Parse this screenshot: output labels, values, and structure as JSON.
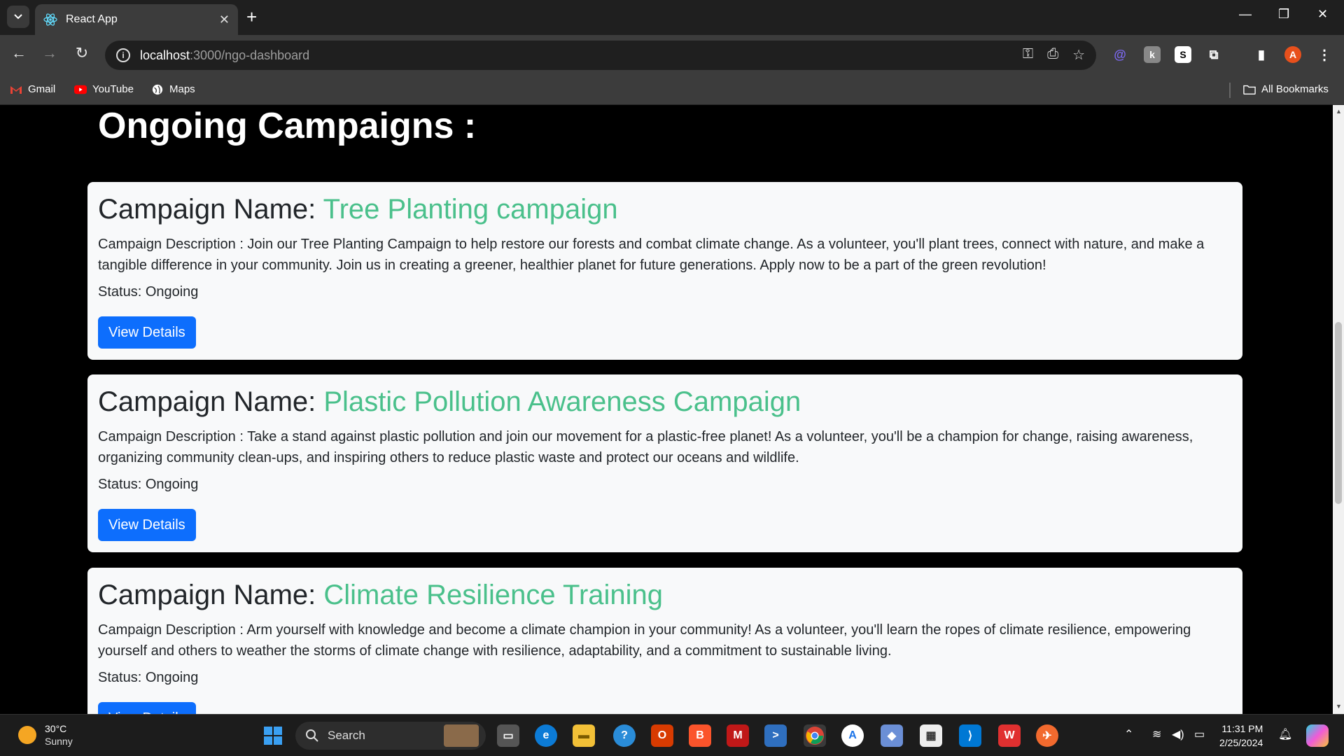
{
  "browser": {
    "tab_title": "React App",
    "url_host": "localhost",
    "url_path": ":3000/ngo-dashboard",
    "bookmarks": [
      "Gmail",
      "YouTube",
      "Maps"
    ],
    "all_bookmarks": "All Bookmarks",
    "profile_initial": "A"
  },
  "page": {
    "heading": "Ongoing Campaigns :",
    "name_prefix": "Campaign Name: ",
    "campaigns": [
      {
        "name": "Tree Planting campaign",
        "description": "Campaign Description : Join our Tree Planting Campaign to help restore our forests and combat climate change. As a volunteer, you'll plant trees, connect with nature, and make a tangible difference in your community. Join us in creating a greener, healthier planet for future generations. Apply now to be a part of the green revolution!",
        "status": "Status: Ongoing",
        "button": "View Details"
      },
      {
        "name": "Plastic Pollution Awareness Campaign",
        "description": "Campaign Description : Take a stand against plastic pollution and join our movement for a plastic-free planet! As a volunteer, you'll be a champion for change, raising awareness, organizing community clean-ups, and inspiring others to reduce plastic waste and protect our oceans and wildlife.",
        "status": "Status: Ongoing",
        "button": "View Details"
      },
      {
        "name": "Climate Resilience Training",
        "description": "Campaign Description : Arm yourself with knowledge and become a climate champion in your community! As a volunteer, you'll learn the ropes of climate resilience, empowering yourself and others to weather the storms of climate change with resilience, adaptability, and a commitment to sustainable living.",
        "status": "Status: Ongoing",
        "button": "View Details"
      }
    ]
  },
  "taskbar": {
    "temperature": "30°C",
    "condition": "Sunny",
    "search_placeholder": "Search",
    "time": "11:31 PM",
    "date": "2/25/2024"
  },
  "colors": {
    "accent_green": "#4ac08b",
    "button_blue": "#0d6efd",
    "card_bg": "#f8f9fa"
  }
}
